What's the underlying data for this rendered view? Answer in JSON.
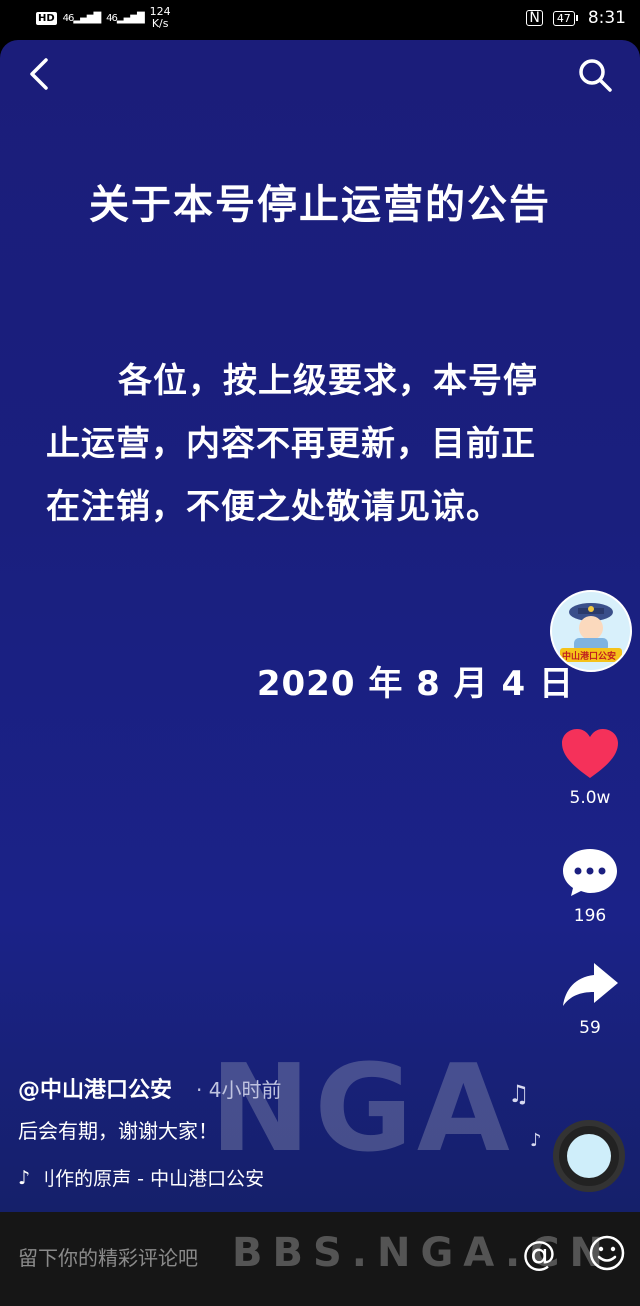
{
  "status_bar": {
    "hd": "HD",
    "sig1": "46",
    "sig2": "46",
    "speed_value": "124",
    "speed_unit": "K/s",
    "nfc": "N",
    "battery": "47",
    "time": "8:31"
  },
  "notice": {
    "title": "关于本号停止运营的公告",
    "body": "各位，按上级要求，本号停止运营，内容不再更新，目前正在注销，不便之处敬请见谅。",
    "date": "2020 年 8 月 4 日"
  },
  "avatar_badge": "中山港口公安",
  "actions": {
    "likes": "5.0w",
    "comments": "196",
    "shares": "59"
  },
  "post": {
    "author": "@中山港口公安",
    "time": "· 4小时前",
    "caption": "后会有期，谢谢大家！",
    "music": "刂作的原声 - 中山港口公安"
  },
  "watermark": "NGA",
  "comment_bar": {
    "placeholder": "留下你的精彩评论吧",
    "watermark": "BBS.NGA.CN",
    "at": "@"
  },
  "icons": [
    "back-icon",
    "search-icon",
    "heart-icon",
    "comment-icon",
    "share-icon",
    "music-note-icon",
    "emoji-icon"
  ],
  "colors": {
    "heart": "#f5315a",
    "background": "#1b1f80"
  }
}
